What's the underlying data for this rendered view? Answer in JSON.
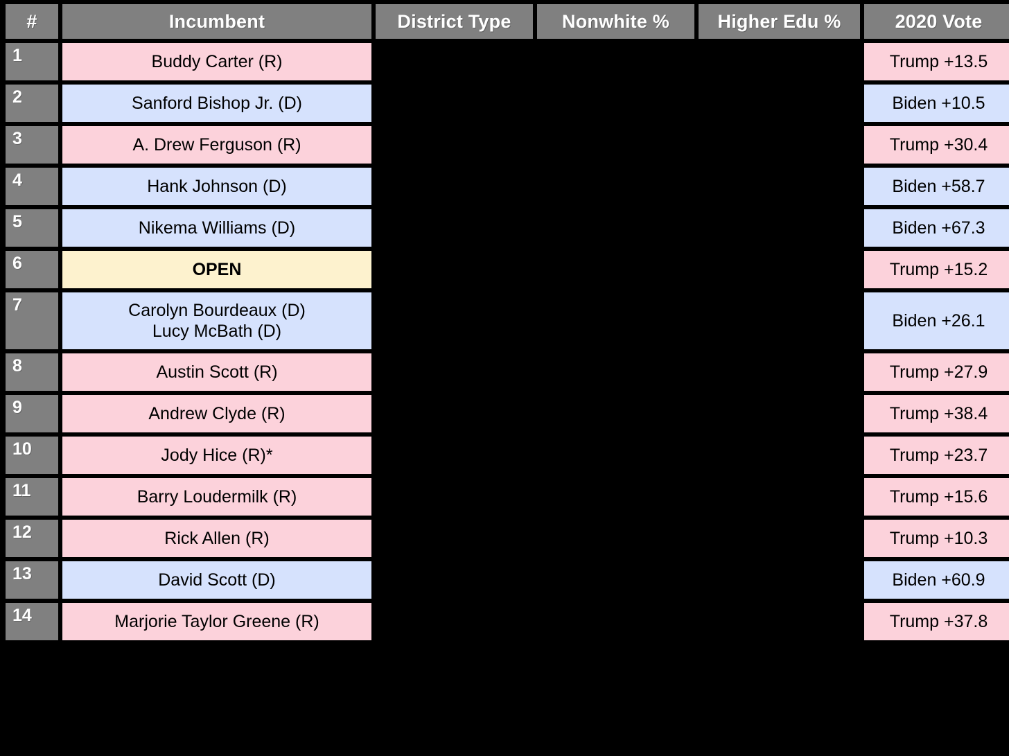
{
  "table": {
    "columns": [
      {
        "key": "num",
        "label": "#"
      },
      {
        "key": "incumbent",
        "label": "Incumbent"
      },
      {
        "key": "type",
        "label": "District Type"
      },
      {
        "key": "nonwhite",
        "label": "Nonwhite %"
      },
      {
        "key": "edu",
        "label": "Higher Edu %"
      },
      {
        "key": "vote",
        "label": "2020 Vote"
      }
    ],
    "colors": {
      "header_bg": "#808080",
      "header_text": "#ffffff",
      "republican_fill": "#fcd2db",
      "democrat_fill": "#d6e2fd",
      "open_fill": "#fdf2ce",
      "blank_fill": "#000000",
      "page_bg": "#000000",
      "grid_line": "#000000"
    },
    "rows": [
      {
        "num": "1",
        "incumbent": "Buddy Carter (R)",
        "incumbent_fill": "rep",
        "type": "",
        "nonwhite": "",
        "edu": "",
        "vote": "Trump +13.5",
        "vote_fill": "rep"
      },
      {
        "num": "2",
        "incumbent": "Sanford Bishop Jr. (D)",
        "incumbent_fill": "dem",
        "type": "",
        "nonwhite": "",
        "edu": "",
        "vote": "Biden +10.5",
        "vote_fill": "dem"
      },
      {
        "num": "3",
        "incumbent": "A. Drew Ferguson (R)",
        "incumbent_fill": "rep",
        "type": "",
        "nonwhite": "",
        "edu": "",
        "vote": "Trump +30.4",
        "vote_fill": "rep"
      },
      {
        "num": "4",
        "incumbent": "Hank Johnson (D)",
        "incumbent_fill": "dem",
        "type": "",
        "nonwhite": "",
        "edu": "",
        "vote": "Biden +58.7",
        "vote_fill": "dem"
      },
      {
        "num": "5",
        "incumbent": "Nikema Williams (D)",
        "incumbent_fill": "dem",
        "type": "",
        "nonwhite": "",
        "edu": "",
        "vote": "Biden +67.3",
        "vote_fill": "dem"
      },
      {
        "num": "6",
        "incumbent": "OPEN",
        "incumbent_fill": "open",
        "type": "",
        "nonwhite": "",
        "edu": "",
        "vote": "Trump +15.2",
        "vote_fill": "rep"
      },
      {
        "num": "7",
        "incumbent": "Carolyn Bourdeaux (D)\nLucy McBath (D)",
        "incumbent_fill": "dem",
        "type": "",
        "nonwhite": "",
        "edu": "",
        "vote": "Biden +26.1",
        "vote_fill": "dem",
        "tall": true
      },
      {
        "num": "8",
        "incumbent": "Austin Scott (R)",
        "incumbent_fill": "rep",
        "type": "",
        "nonwhite": "",
        "edu": "",
        "vote": "Trump +27.9",
        "vote_fill": "rep"
      },
      {
        "num": "9",
        "incumbent": "Andrew Clyde (R)",
        "incumbent_fill": "rep",
        "type": "",
        "nonwhite": "",
        "edu": "",
        "vote": "Trump +38.4",
        "vote_fill": "rep"
      },
      {
        "num": "10",
        "incumbent": "Jody Hice (R)*",
        "incumbent_fill": "rep",
        "type": "",
        "nonwhite": "",
        "edu": "",
        "vote": "Trump +23.7",
        "vote_fill": "rep"
      },
      {
        "num": "11",
        "incumbent": "Barry Loudermilk (R)",
        "incumbent_fill": "rep",
        "type": "",
        "nonwhite": "",
        "edu": "",
        "vote": "Trump +15.6",
        "vote_fill": "rep"
      },
      {
        "num": "12",
        "incumbent": "Rick Allen (R)",
        "incumbent_fill": "rep",
        "type": "",
        "nonwhite": "",
        "edu": "",
        "vote": "Trump +10.3",
        "vote_fill": "rep"
      },
      {
        "num": "13",
        "incumbent": "David Scott (D)",
        "incumbent_fill": "dem",
        "type": "",
        "nonwhite": "",
        "edu": "",
        "vote": "Biden +60.9",
        "vote_fill": "dem"
      },
      {
        "num": "14",
        "incumbent": "Marjorie Taylor Greene (R)",
        "incumbent_fill": "rep",
        "type": "",
        "nonwhite": "",
        "edu": "",
        "vote": "Trump +37.8",
        "vote_fill": "rep"
      }
    ]
  }
}
